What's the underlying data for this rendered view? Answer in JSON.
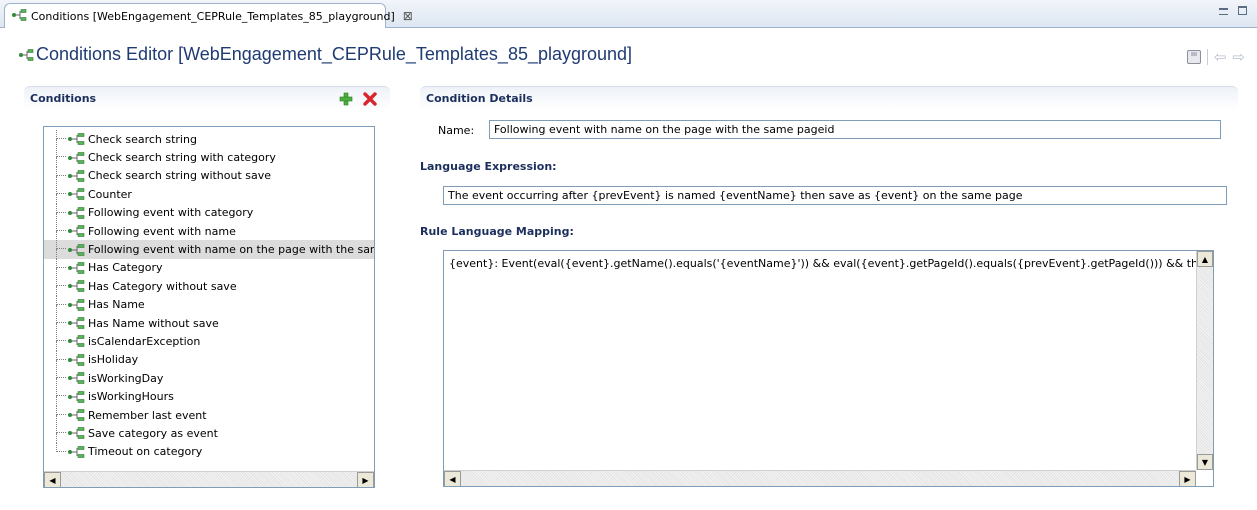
{
  "tab": {
    "label": "Conditions [WebEngagement_CEPRule_Templates_85_playground]",
    "close_glyph": "⊠",
    "icon": "conditions-node-icon"
  },
  "window_controls": {
    "minimize": "minimize-icon",
    "maximize": "maximize-icon"
  },
  "editor": {
    "title": "Conditions Editor [WebEngagement_CEPRule_Templates_85_playground]",
    "toolbar": {
      "save": "save-icon",
      "back": "back-arrow-icon",
      "forward": "forward-arrow-icon"
    }
  },
  "conditions_panel": {
    "title": "Conditions",
    "add_icon": "add-icon",
    "remove_icon": "remove-icon",
    "items": [
      "Check search string",
      "Check search string with category",
      "Check search string without save",
      "Counter",
      "Following event with category",
      "Following event with name",
      "Following event with name on the page with the same",
      "Has Category",
      "Has Category without save",
      "Has Name",
      "Has Name without save",
      "isCalendarException",
      "isHoliday",
      "isWorkingDay",
      "isWorkingHours",
      "Remember last event",
      "Save category as event",
      "Timeout on category"
    ],
    "selected_index": 6
  },
  "details_panel": {
    "title": "Condition Details",
    "name_label": "Name:",
    "name_value": "Following event with name on the page with the same pageid",
    "language_expression_label": "Language Expression:",
    "language_expression_value": "The event occurring after {prevEvent} is named {eventName} then save as {event} on the same page",
    "rule_mapping_label": "Rule Language Mapping:",
    "rule_mapping_value": "{event}: Event(eval({event}.getName().equals('{eventName}')) && eval({event}.getPageId().equals({prevEvent}.getPageId())) && this after"
  },
  "colors": {
    "title_blue": "#1f3b73",
    "section_text": "#1c2f5c",
    "selection_gray": "#dcdcdc",
    "border_blue": "#7f9db9"
  }
}
